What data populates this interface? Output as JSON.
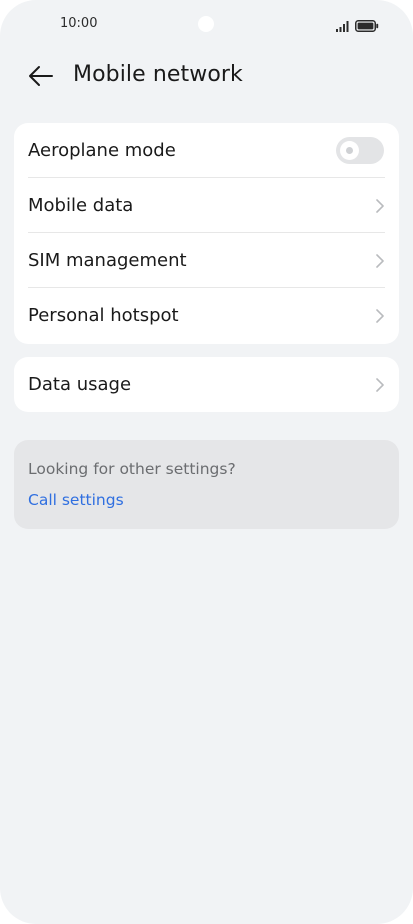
{
  "status_bar": {
    "time": "10:00",
    "icons": [
      "signal-icon",
      "battery-icon"
    ]
  },
  "header": {
    "back_icon": "back-arrow-icon",
    "title": "Mobile network"
  },
  "settings_main": {
    "items": [
      {
        "label": "Aeroplane mode",
        "control": "toggle",
        "toggle_on": false
      },
      {
        "label": "Mobile data",
        "control": "chevron"
      },
      {
        "label": "SIM management",
        "control": "chevron"
      },
      {
        "label": "Personal hotspot",
        "control": "chevron"
      }
    ]
  },
  "settings_usage": {
    "items": [
      {
        "label": "Data usage",
        "control": "chevron"
      }
    ]
  },
  "suggestion": {
    "title": "Looking for other settings?",
    "link": "Call settings"
  },
  "colors": {
    "background": "#f1f3f5",
    "card": "#ffffff",
    "suggestion_card": "#e5e6e8",
    "link": "#2f6fe0",
    "toggle_off": "#e3e4e6"
  }
}
